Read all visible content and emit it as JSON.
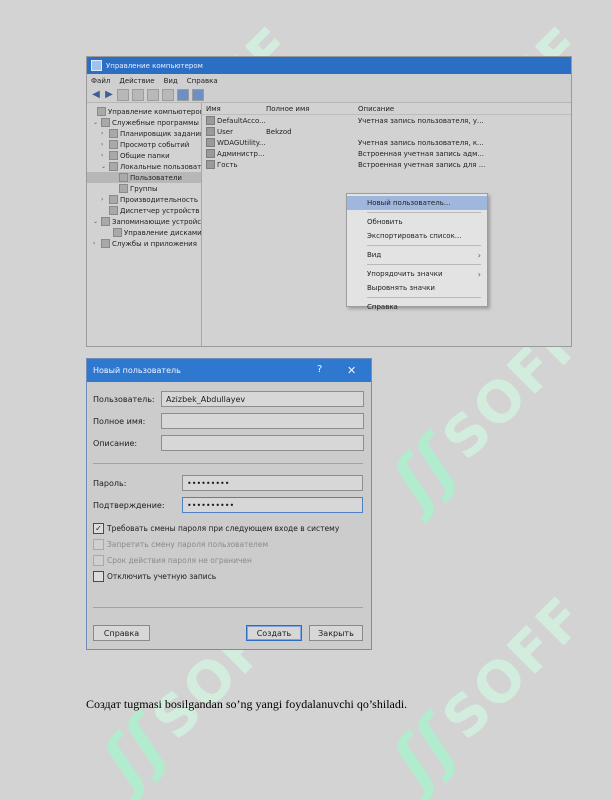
{
  "window": {
    "title": "Управление компьютером",
    "menu": [
      "Файл",
      "Действие",
      "Вид",
      "Справка"
    ]
  },
  "tree": [
    {
      "label": "Управление компьютером (л",
      "level": 0,
      "expanded": true
    },
    {
      "label": "Служебные программы",
      "level": 1,
      "expanded": true
    },
    {
      "label": "Планировщик заданий",
      "level": 2
    },
    {
      "label": "Просмотр событий",
      "level": 2
    },
    {
      "label": "Общие папки",
      "level": 2
    },
    {
      "label": "Локальные пользовате",
      "level": 2,
      "expanded": true
    },
    {
      "label": "Пользователи",
      "level": 3,
      "selected": true
    },
    {
      "label": "Группы",
      "level": 3
    },
    {
      "label": "Производительность",
      "level": 2
    },
    {
      "label": "Диспетчер устройств",
      "level": 2
    },
    {
      "label": "Запоминающие устройст",
      "level": 1,
      "expanded": true
    },
    {
      "label": "Управление дисками",
      "level": 2
    },
    {
      "label": "Службы и приложения",
      "level": 1
    }
  ],
  "list": {
    "headers": {
      "name": "Имя",
      "full": "Полное имя",
      "desc": "Описание"
    },
    "rows": [
      {
        "name": "DefaultAcco...",
        "full": "",
        "desc": "Учетная запись пользователя, у..."
      },
      {
        "name": "User",
        "full": "Bekzod",
        "desc": ""
      },
      {
        "name": "WDAGUtility...",
        "full": "",
        "desc": "Учетная запись пользователя, к..."
      },
      {
        "name": "Администр...",
        "full": "",
        "desc": "Встроенная учетная запись адм..."
      },
      {
        "name": "Гость",
        "full": "",
        "desc": "Встроенная учетная запись для ..."
      }
    ]
  },
  "context_menu": {
    "new_user": "Новый пользователь...",
    "refresh": "Обновить",
    "export": "Экспортировать список...",
    "view": "Вид",
    "arrange": "Упорядочить значки",
    "align": "Выровнять значки",
    "help": "Справка"
  },
  "dialog": {
    "title": "Новый пользователь",
    "help_glyph": "?",
    "close_glyph": "✕",
    "user_label": "Пользователь:",
    "user_value": "Azizbek_Abdullayev",
    "fullname_label": "Полное имя:",
    "fullname_value": "",
    "desc_label": "Описание:",
    "desc_value": "",
    "password_label": "Пароль:",
    "password_value": "•••••••••",
    "confirm_label": "Подтверждение:",
    "confirm_value": "••••••••••",
    "check_change": "Требовать смены пароля при следующем входе в систему",
    "check_prohibit": "Запретить смену пароля пользователем",
    "check_never": "Срок действия пароля не ограничен",
    "check_disable": "Отключить учетную запись",
    "check_mark": "✓",
    "btn_help": "Справка",
    "btn_create": "Создать",
    "btn_close": "Закрыть",
    "change_checked": true
  },
  "caption": "Создат tugmasi bosilgandan so’ng yangi foydalanuvchi qo’shiladi.",
  "watermark": {
    "text": "SOFF",
    "glyph": "ʃʃ"
  }
}
